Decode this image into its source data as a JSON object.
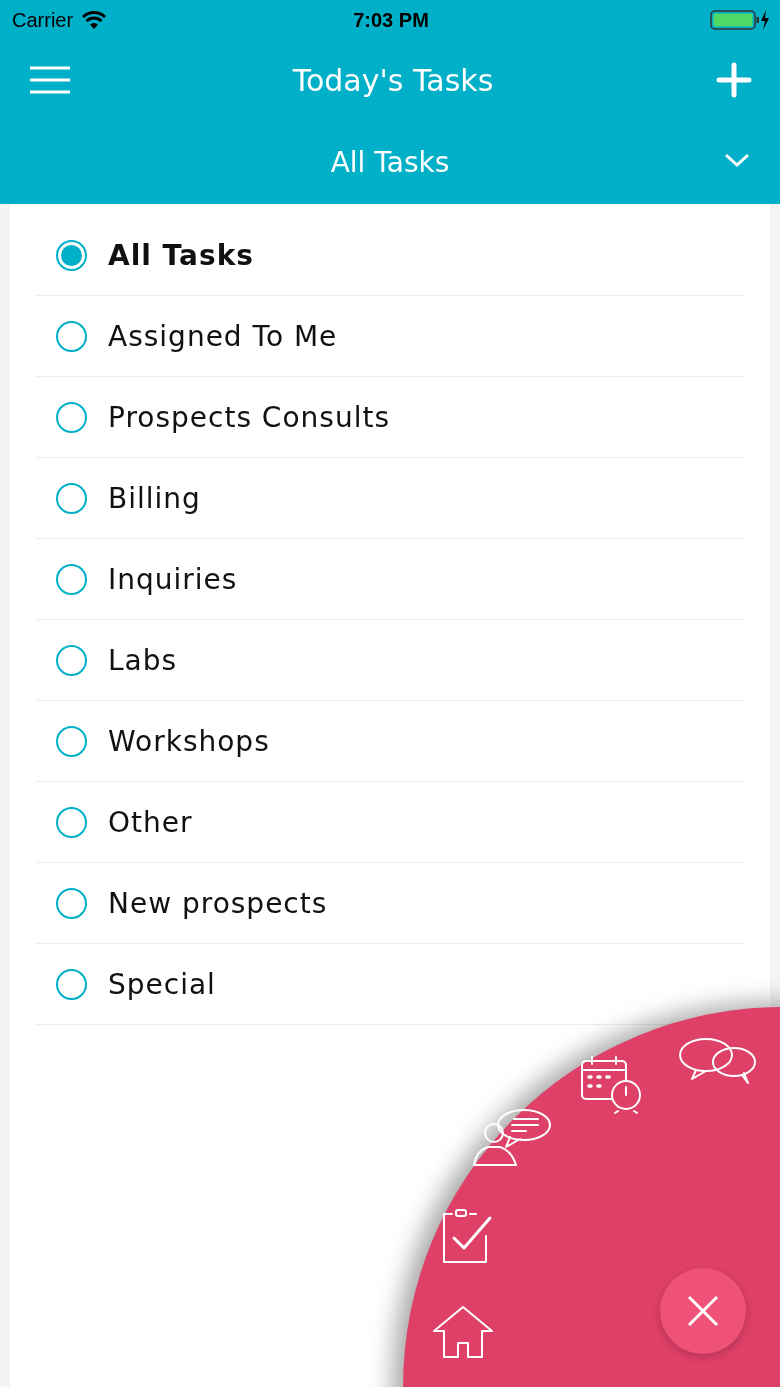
{
  "status_bar": {
    "carrier": "Carrier",
    "time": "7:03 PM"
  },
  "header": {
    "title": "Today's Tasks"
  },
  "filter": {
    "label": "All Tasks"
  },
  "options": [
    {
      "label": "All Tasks",
      "selected": true
    },
    {
      "label": "Assigned To Me",
      "selected": false
    },
    {
      "label": "Prospects Consults",
      "selected": false
    },
    {
      "label": "Billing",
      "selected": false
    },
    {
      "label": "Inquiries",
      "selected": false
    },
    {
      "label": "Labs",
      "selected": false
    },
    {
      "label": "Workshops",
      "selected": false
    },
    {
      "label": "Other",
      "selected": false
    },
    {
      "label": "New prospects",
      "selected": false
    },
    {
      "label": "Special",
      "selected": false
    }
  ]
}
